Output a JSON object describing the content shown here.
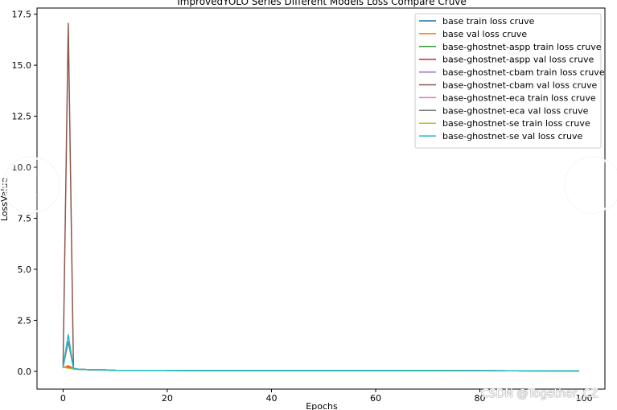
{
  "chart_data": {
    "type": "line",
    "title": "ImprovedYOLO Series Different Models Loss Compare Cruve",
    "xlabel": "Epochs",
    "ylabel": "LossValue",
    "xlim": [
      -5,
      104
    ],
    "ylim": [
      -0.87,
      17.8
    ],
    "xticks": [
      0,
      20,
      40,
      60,
      80,
      100
    ],
    "yticks": [
      0.0,
      2.5,
      5.0,
      7.5,
      10.0,
      12.5,
      15.0,
      17.5
    ],
    "grid": false,
    "legend_position": "top-right",
    "series": [
      {
        "name": "base train loss cruve",
        "color": "#1f77b4",
        "points": [
          [
            0,
            0.2
          ],
          [
            1,
            0.17
          ],
          [
            2,
            0.12
          ],
          [
            3,
            0.1
          ],
          [
            5,
            0.08
          ],
          [
            8,
            0.07
          ],
          [
            10,
            0.05
          ],
          [
            30,
            0.04
          ],
          [
            60,
            0.04
          ],
          [
            99,
            0.02
          ]
        ]
      },
      {
        "name": "base val loss cruve",
        "color": "#ff7f0e",
        "points": [
          [
            0,
            0.18
          ],
          [
            1,
            0.28
          ],
          [
            2,
            0.14
          ],
          [
            3,
            0.1
          ],
          [
            5,
            0.08
          ],
          [
            8,
            0.07
          ],
          [
            10,
            0.05
          ],
          [
            30,
            0.04
          ],
          [
            60,
            0.04
          ],
          [
            99,
            0.02
          ]
        ]
      },
      {
        "name": "base-ghostnet-aspp train loss cruve",
        "color": "#2ca02c",
        "points": [
          [
            0,
            0.2
          ],
          [
            1,
            0.17
          ],
          [
            2,
            0.12
          ],
          [
            3,
            0.1
          ],
          [
            5,
            0.08
          ],
          [
            8,
            0.07
          ],
          [
            10,
            0.05
          ],
          [
            30,
            0.04
          ],
          [
            60,
            0.04
          ],
          [
            99,
            0.02
          ]
        ]
      },
      {
        "name": "base-ghostnet-aspp val loss cruve",
        "color": "#d62728",
        "points": [
          [
            0,
            0.18
          ],
          [
            1,
            0.22
          ],
          [
            2,
            0.14
          ],
          [
            3,
            0.1
          ],
          [
            5,
            0.08
          ],
          [
            8,
            0.07
          ],
          [
            10,
            0.05
          ],
          [
            30,
            0.04
          ],
          [
            60,
            0.04
          ],
          [
            99,
            0.02
          ]
        ]
      },
      {
        "name": "base-ghostnet-cbam train loss cruve",
        "color": "#9467bd",
        "points": [
          [
            0,
            0.2
          ],
          [
            1,
            0.17
          ],
          [
            2,
            0.12
          ],
          [
            3,
            0.1
          ],
          [
            5,
            0.08
          ],
          [
            8,
            0.07
          ],
          [
            10,
            0.05
          ],
          [
            30,
            0.04
          ],
          [
            60,
            0.04
          ],
          [
            99,
            0.02
          ]
        ]
      },
      {
        "name": "base-ghostnet-cbam val loss cruve",
        "color": "#8c564b",
        "points": [
          [
            0,
            0.22
          ],
          [
            1,
            17.05
          ],
          [
            2,
            0.15
          ],
          [
            3,
            0.1
          ],
          [
            5,
            0.08
          ],
          [
            8,
            0.07
          ],
          [
            10,
            0.05
          ],
          [
            30,
            0.04
          ],
          [
            60,
            0.04
          ],
          [
            99,
            0.02
          ]
        ]
      },
      {
        "name": "base-ghostnet-eca train loss cruve",
        "color": "#e377c2",
        "points": [
          [
            0,
            0.2
          ],
          [
            1,
            0.17
          ],
          [
            2,
            0.12
          ],
          [
            3,
            0.1
          ],
          [
            5,
            0.08
          ],
          [
            8,
            0.07
          ],
          [
            10,
            0.05
          ],
          [
            30,
            0.04
          ],
          [
            60,
            0.04
          ],
          [
            99,
            0.02
          ]
        ]
      },
      {
        "name": "base-ghostnet-eca val loss cruve",
        "color": "#7f7f7f",
        "points": [
          [
            0,
            0.2
          ],
          [
            1,
            1.45
          ],
          [
            2,
            0.15
          ],
          [
            3,
            0.1
          ],
          [
            5,
            0.08
          ],
          [
            8,
            0.07
          ],
          [
            10,
            0.05
          ],
          [
            30,
            0.04
          ],
          [
            60,
            0.04
          ],
          [
            99,
            0.02
          ]
        ]
      },
      {
        "name": "base-ghostnet-se train loss cruve",
        "color": "#bcbd22",
        "points": [
          [
            0,
            0.2
          ],
          [
            1,
            0.17
          ],
          [
            2,
            0.12
          ],
          [
            3,
            0.1
          ],
          [
            5,
            0.08
          ],
          [
            8,
            0.07
          ],
          [
            10,
            0.05
          ],
          [
            30,
            0.04
          ],
          [
            60,
            0.04
          ],
          [
            99,
            0.02
          ]
        ]
      },
      {
        "name": "base-ghostnet-se val loss cruve",
        "color": "#17becf",
        "points": [
          [
            0,
            0.2
          ],
          [
            1,
            1.8
          ],
          [
            2,
            0.15
          ],
          [
            3,
            0.1
          ],
          [
            5,
            0.08
          ],
          [
            8,
            0.07
          ],
          [
            10,
            0.05
          ],
          [
            30,
            0.04
          ],
          [
            60,
            0.04
          ],
          [
            99,
            0.02
          ]
        ]
      }
    ]
  },
  "watermark": "CSDN @Together_CZ",
  "nav": {
    "prev_icon": "chevron-left-icon",
    "next_icon": "chevron-right-icon"
  }
}
